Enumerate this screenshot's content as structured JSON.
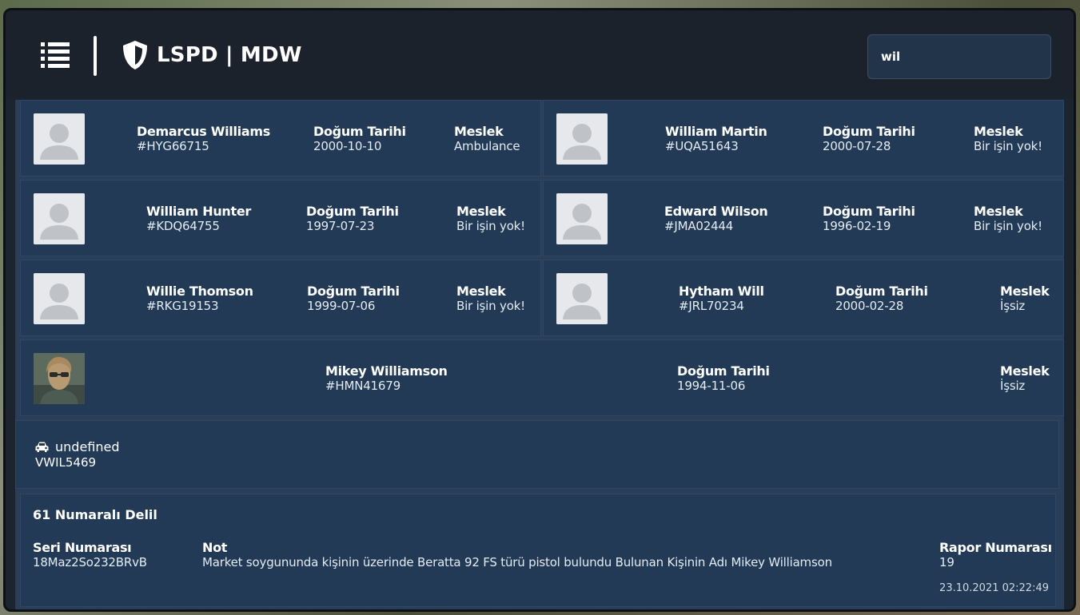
{
  "app": {
    "title": "LSPD | MDW"
  },
  "search": {
    "value": "wil"
  },
  "labels": {
    "dob": "Doğum Tarihi",
    "job": "Meslek"
  },
  "people": [
    {
      "name": "Demarcus Williams",
      "id": "#HYG66715",
      "dob": "2000-10-10",
      "job": "Ambulance"
    },
    {
      "name": "William Martin",
      "id": "#UQA51643",
      "dob": "2000-07-28",
      "job": "Bir işin yok!"
    },
    {
      "name": "William Hunter",
      "id": "#KDQ64755",
      "dob": "1997-07-23",
      "job": "Bir işin yok!"
    },
    {
      "name": "Edward Wilson",
      "id": "#JMA02444",
      "dob": "1996-02-19",
      "job": "Bir işin yok!"
    },
    {
      "name": "Willie Thomson",
      "id": "#RKG19153",
      "dob": "1999-07-06",
      "job": "Bir işin yok!"
    },
    {
      "name": "Hytham Will",
      "id": "#JRL70234",
      "dob": "2000-02-28",
      "job": "İşsiz"
    },
    {
      "name": "Mikey Williamson",
      "id": "#HMN41679",
      "dob": "1994-11-06",
      "job": "İşsiz"
    }
  ],
  "vehicle": {
    "model": "undefined",
    "plate": "VWIL5469"
  },
  "evidence": {
    "title": "61 Numaralı Delil",
    "serial_label": "Seri Numarası",
    "serial_value": "18Maz2So232BRvB",
    "note_label": "Not",
    "note_value": "Market soygununda kişinin üzerinde Beratta 92 FS türü pistol bulundu Bulunan Kişinin Adı Mikey Williamson",
    "report_label": "Rapor Numarası",
    "report_value": "19",
    "timestamp": "23.10.2021 02:22:49"
  }
}
